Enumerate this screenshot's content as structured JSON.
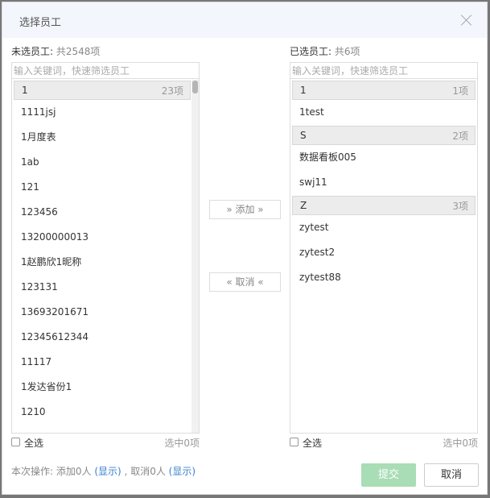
{
  "dialog": {
    "title": "选择员工",
    "close_icon": "close-icon"
  },
  "left": {
    "title_label": "未选员工:",
    "title_count": "共2548项",
    "search_placeholder": "输入关键词，快速筛选员工",
    "group": {
      "title": "1",
      "count": "23项"
    },
    "items": [
      "1111jsj",
      "1月度表",
      "1ab",
      "121",
      "123456",
      "13200000013",
      "1赵鹏欣1昵称",
      "123131",
      "13693201671",
      "12345612344",
      "11117",
      "1发达省份1",
      "1210"
    ],
    "select_all": "全选",
    "selected": "选中0项"
  },
  "right": {
    "title_label": "已选员工:",
    "title_count": "共6项",
    "search_placeholder": "输入关键词，快速筛选员工",
    "groups": [
      {
        "title": "1",
        "count": "1项",
        "items": [
          "1test"
        ]
      },
      {
        "title": "S",
        "count": "2项",
        "items": [
          "数据看板005",
          "swj11"
        ]
      },
      {
        "title": "Z",
        "count": "3项",
        "items": [
          "zytest",
          "zytest2",
          "zytest88"
        ]
      }
    ],
    "select_all": "全选",
    "selected": "选中0项"
  },
  "actions": {
    "add": "» 添加 »",
    "remove": "« 取消 «"
  },
  "footer": {
    "summary_prefix": "本次操作:",
    "added": "添加0人",
    "show1": "(显示)",
    "sep": ",",
    "removed": "取消0人",
    "show2": "(显示)",
    "submit": "提交",
    "cancel": "取消"
  },
  "colors": {
    "submit_bg": "#a8ddb5",
    "link": "#3a7fcc",
    "header_bg": "#f3f6fc"
  }
}
